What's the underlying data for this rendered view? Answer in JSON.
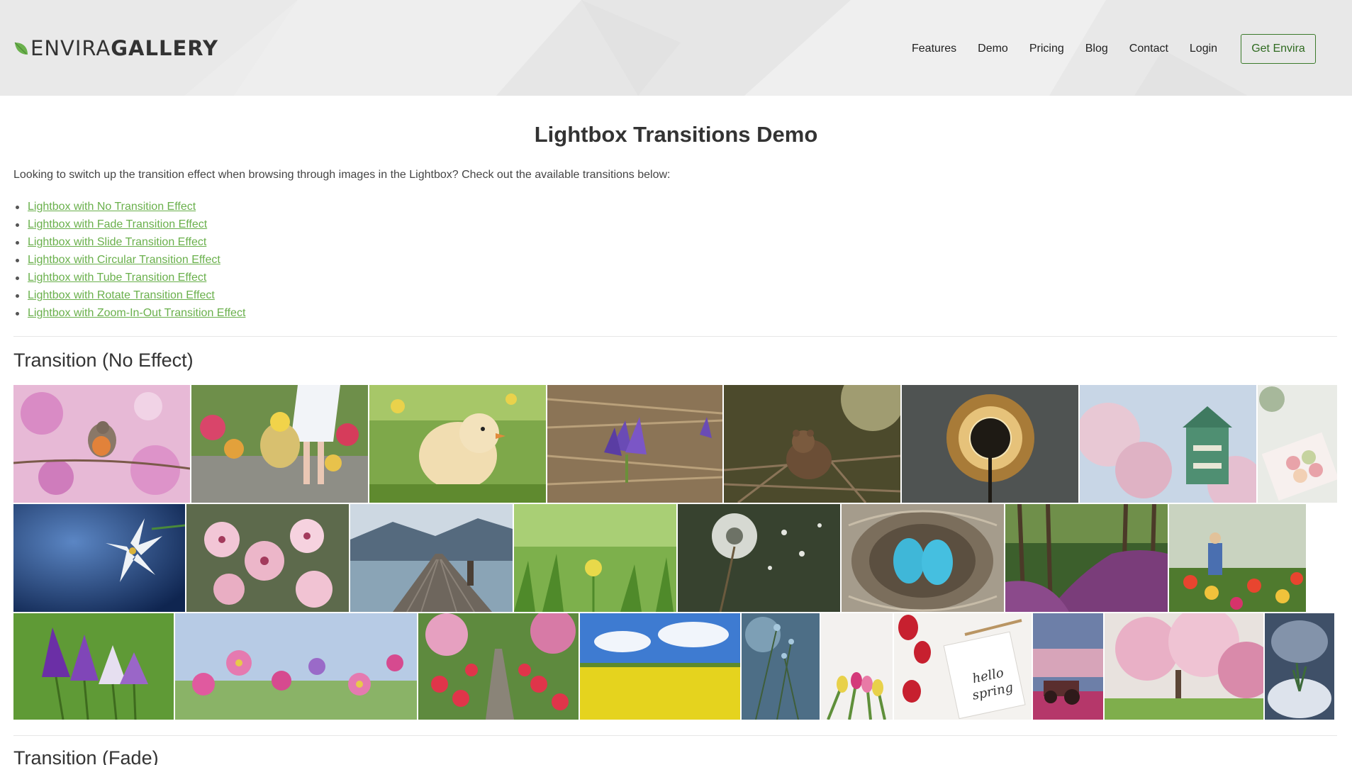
{
  "header": {
    "logo_light": "ENVIRA",
    "logo_bold": "GALLERY",
    "nav": [
      "Features",
      "Demo",
      "Pricing",
      "Blog",
      "Contact",
      "Login"
    ],
    "cta": "Get Envira",
    "brand_color": "#6ab04c"
  },
  "main": {
    "title": "Lightbox Transitions Demo",
    "intro": "Looking to switch up the transition effect when browsing through images in the Lightbox? Check out the available transitions below:",
    "links": [
      "Lightbox with No Transition Effect",
      "Lightbox with Fade Transition Effect",
      "Lightbox with Slide Transition Effect",
      "Lightbox with Circular Transition Effect",
      "Lightbox with Tube Transition Effect",
      "Lightbox with Rotate Transition Effect",
      "Lightbox with Zoom-In-Out Transition Effect"
    ],
    "section1_title": "Transition (No Effect)",
    "section2_title": "Transition (Fade)"
  },
  "gallery": {
    "rows": [
      [
        "robin-on-pink-blossom",
        "girl-white-dress-tulips",
        "baby-chick-in-grass",
        "purple-crocus-in-straw",
        "bear-cub-in-branches",
        "dandelion-silhouette",
        "cherry-blossom-castle",
        "macarons-box"
      ],
      [
        "white-lily-on-blue",
        "pink-cherry-blossoms",
        "wooden-pier-lake",
        "green-grass-yellow-flower",
        "dandelion-seeds",
        "blue-eggs-in-nest",
        "purple-flower-forest-path",
        "girl-in-tulip-field"
      ],
      [
        "purple-crocus-flowers",
        "pink-cosmos-flowers",
        "garden-path-tulips",
        "yellow-rapeseed-field",
        "blue-snowdrop-buds",
        "colorful-tulips",
        "hello-spring-card",
        "tractor-at-sunset",
        "blossoming-tree-park",
        "snowdrop-in-snow"
      ]
    ]
  }
}
